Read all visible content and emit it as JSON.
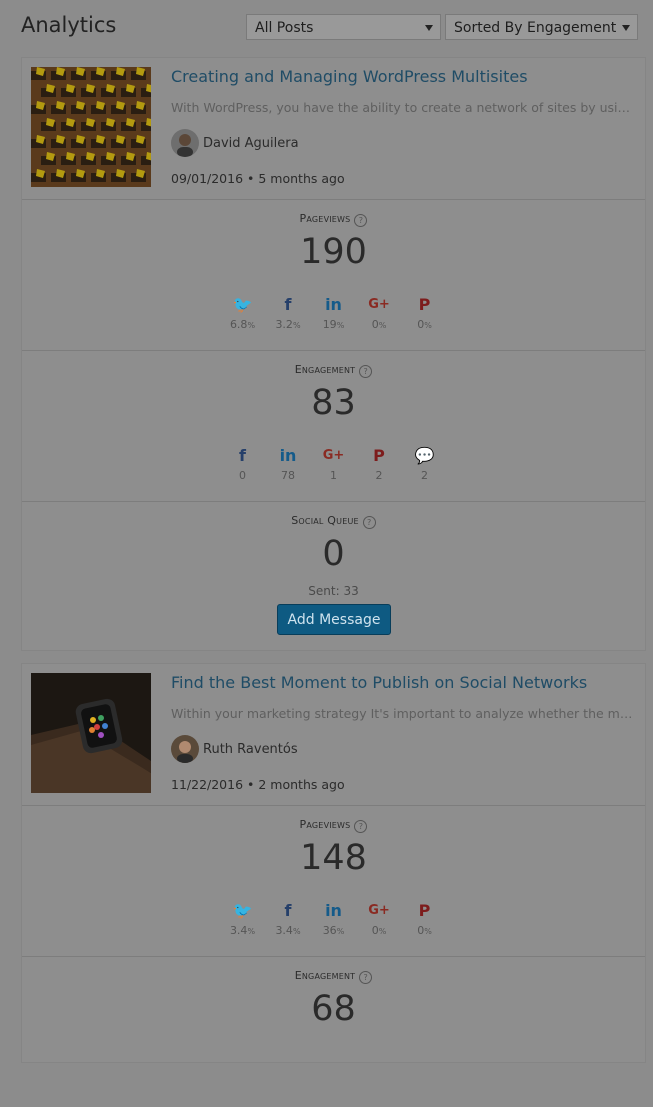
{
  "header": {
    "title": "Analytics",
    "filter_select": "All Posts",
    "sort_select": "Sorted By Engagement"
  },
  "posts": [
    {
      "title": "Creating and Managing WordPress Multisites",
      "excerpt": "With WordPress, you have the ability to create a network of sites by using th…",
      "author": "David Aguilera",
      "date": "09/01/2016 • 5 months ago",
      "pageviews": {
        "label": "Pageviews",
        "value": "190",
        "stats": [
          {
            "network": "twitter-icon",
            "value": "6.8",
            "unit": "%"
          },
          {
            "network": "facebook-icon",
            "value": "3.2",
            "unit": "%"
          },
          {
            "network": "linkedin-icon",
            "value": "19",
            "unit": "%"
          },
          {
            "network": "google-plus-icon",
            "value": "0",
            "unit": "%"
          },
          {
            "network": "pinterest-icon",
            "value": "0",
            "unit": "%"
          }
        ]
      },
      "engagement": {
        "label": "Engagement",
        "value": "83",
        "stats": [
          {
            "network": "facebook-icon",
            "value": "0"
          },
          {
            "network": "linkedin-icon",
            "value": "78"
          },
          {
            "network": "google-plus-icon",
            "value": "1"
          },
          {
            "network": "pinterest-icon",
            "value": "2"
          },
          {
            "network": "comment-icon",
            "value": "2"
          }
        ]
      },
      "social_queue": {
        "label": "Social Queue",
        "value": "0",
        "sent": "Sent: 33",
        "button": "Add Message"
      }
    },
    {
      "title": "Find the Best Moment to Publish on Social Networks",
      "excerpt": "Within your marketing strategy It's important to analyze whether the mome…",
      "author": "Ruth Raventós",
      "date": "11/22/2016 • 2 months ago",
      "pageviews": {
        "label": "Pageviews",
        "value": "148",
        "stats": [
          {
            "network": "twitter-icon",
            "value": "3.4",
            "unit": "%"
          },
          {
            "network": "facebook-icon",
            "value": "3.4",
            "unit": "%"
          },
          {
            "network": "linkedin-icon",
            "value": "36",
            "unit": "%"
          },
          {
            "network": "google-plus-icon",
            "value": "0",
            "unit": "%"
          },
          {
            "network": "pinterest-icon",
            "value": "0",
            "unit": "%"
          }
        ]
      },
      "engagement": {
        "label": "Engagement",
        "value": "68"
      }
    }
  ],
  "colors": {
    "background": "#8c8c8c",
    "link": "#1f4c66",
    "button": "#0e5a82"
  }
}
